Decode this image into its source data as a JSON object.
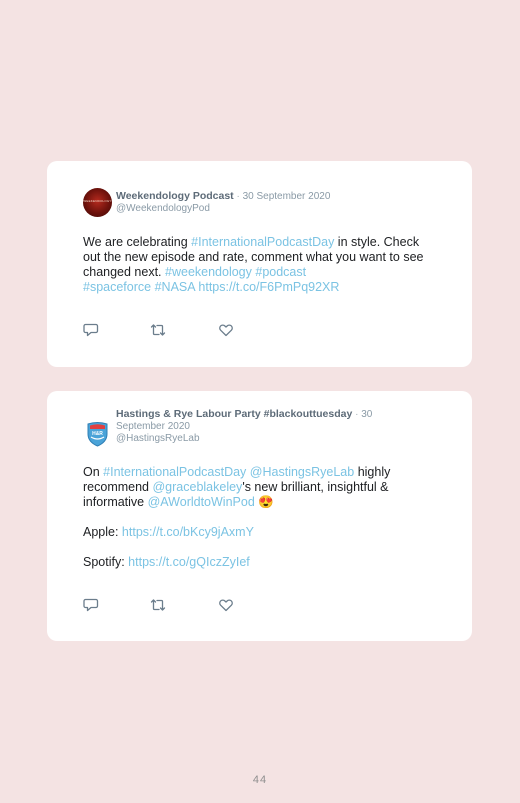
{
  "tweets": [
    {
      "name": "Weekendology Podcast",
      "separator": " · ",
      "date": "30 September 2020",
      "handle": "@WeekendologyPod",
      "avatar_text": "WEEKENDOLOGY",
      "body": [
        {
          "t": "We are celebrating ",
          "link": false
        },
        {
          "t": "#InternationalPodcastDay",
          "link": true
        },
        {
          "t": " in style. Check out the new episode and rate, comment what you want to see changed next. ",
          "link": false
        },
        {
          "t": "#weekendology",
          "link": true
        },
        {
          "t": " ",
          "link": false
        },
        {
          "t": "#podcast",
          "link": true
        },
        {
          "t": " ",
          "link": false
        },
        {
          "t": "#spaceforce",
          "link": true
        },
        {
          "t": " ",
          "link": false
        },
        {
          "t": "#NASA",
          "link": true
        },
        {
          "t": " ",
          "link": false
        },
        {
          "t": "https://t.co/F6PmPq92XR",
          "link": true
        }
      ]
    },
    {
      "name": "Hastings & Rye Labour Party #blackouttuesday",
      "separator": " · ",
      "date": "30 September 2020",
      "handle": "@HastingsRyeLab",
      "avatar_text": "H&R",
      "para1": [
        {
          "t": "On ",
          "link": false
        },
        {
          "t": "#InternationalPodcastDay",
          "link": true
        },
        {
          "t": " ",
          "link": false
        },
        {
          "t": "@HastingsRyeLab",
          "link": true
        },
        {
          "t": " highly recommend ",
          "link": false
        },
        {
          "t": "@graceblakeley",
          "link": true
        },
        {
          "t": "'s new brilliant, insightful & informative ",
          "link": false
        },
        {
          "t": "@AWorldtoWinPod",
          "link": true
        },
        {
          "t": " 😍",
          "link": false
        }
      ],
      "apple_label": "Apple: ",
      "apple_link": "https://t.co/bKcy9jAxmY",
      "spotify_label": "Spotify: ",
      "spotify_link": "https://t.co/gQIczZyIef"
    }
  ],
  "icons": {
    "reply": "reply-icon",
    "retweet": "retweet-icon",
    "like": "heart-icon"
  },
  "colors": {
    "background": "#f4e3e3",
    "card": "#ffffff",
    "link": "#7bc3e3",
    "meta": "#8a9aa6",
    "icon": "#6b7d8c"
  },
  "page_number": "44"
}
